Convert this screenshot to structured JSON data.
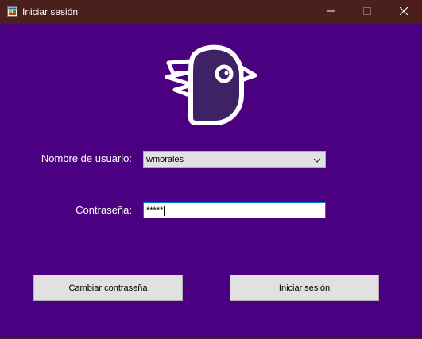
{
  "window": {
    "title": "Iniciar sesión",
    "background_color": "#4b0082",
    "titlebar_color": "#4a1f1c",
    "controls": {
      "minimize_icon": "minimize-icon",
      "maximize_icon": "maximize-icon",
      "close_icon": "close-icon"
    }
  },
  "logo": {
    "icon": "bird-logo-icon"
  },
  "form": {
    "username_label": "Nombre de usuario:",
    "username_value": "wmorales",
    "password_label": "Contraseña:",
    "password_masked": "*****"
  },
  "buttons": {
    "change_password": "Cambiar contraseña",
    "login": "Iniciar sesión"
  }
}
